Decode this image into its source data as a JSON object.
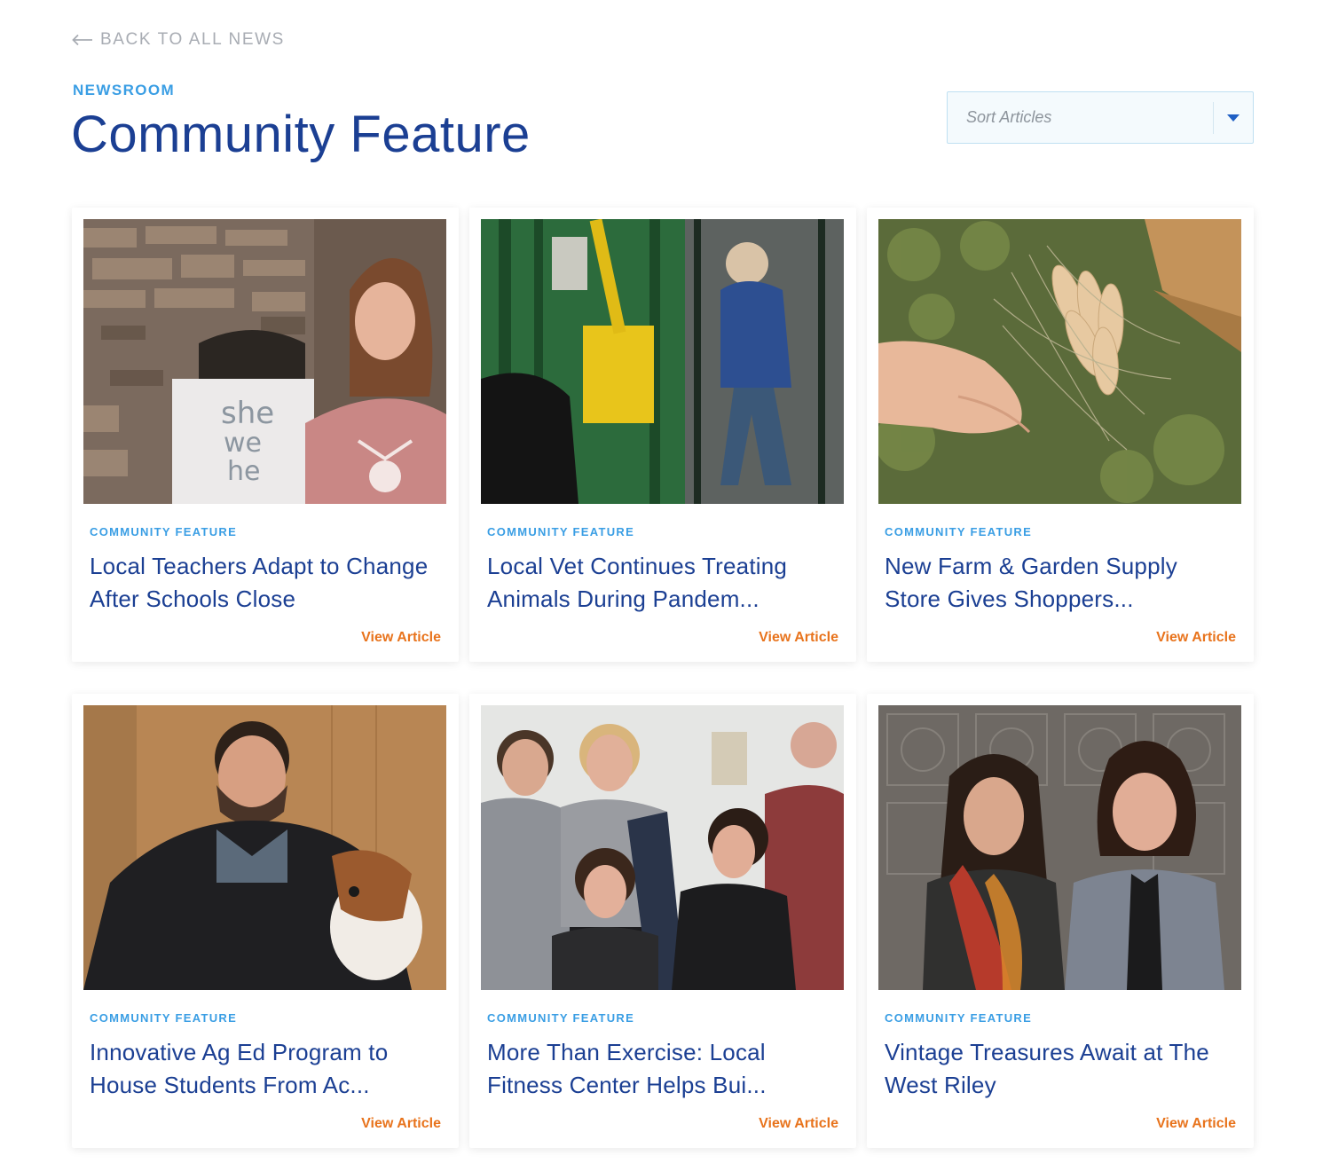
{
  "nav": {
    "back_label": "BACK TO ALL NEWS"
  },
  "header": {
    "eyebrow": "NEWSROOM",
    "title": "Community Feature"
  },
  "sort": {
    "placeholder": "Sort Articles"
  },
  "colors": {
    "accent_blue": "#3a9ee4",
    "title_navy": "#1b3f93",
    "link_orange": "#e8731c"
  },
  "articles": [
    {
      "tag": "COMMUNITY FEATURE",
      "title": "Local Teachers Adapt to Change After Schools Close",
      "link": "View Article",
      "image": "teacher-whiteboard-photo"
    },
    {
      "tag": "COMMUNITY FEATURE",
      "title": "Local Vet Continues Treating Animals During Pandem...",
      "link": "View Article",
      "image": "vet-cattle-chute-photo"
    },
    {
      "tag": "COMMUNITY FEATURE",
      "title": "New Farm & Garden Supply Store Gives Shoppers...",
      "link": "View Article",
      "image": "onion-sets-photo"
    },
    {
      "tag": "COMMUNITY FEATURE",
      "title": "Innovative Ag Ed Program to House Students From Ac...",
      "link": "View Article",
      "image": "man-with-goat-photo"
    },
    {
      "tag": "COMMUNITY FEATURE",
      "title": "More Than Exercise: Local Fitness Center Helps Bui...",
      "link": "View Article",
      "image": "fitness-group-photo"
    },
    {
      "tag": "COMMUNITY FEATURE",
      "title": "Vintage Treasures Await at The West Riley",
      "link": "View Article",
      "image": "two-women-tin-wall-photo"
    }
  ]
}
